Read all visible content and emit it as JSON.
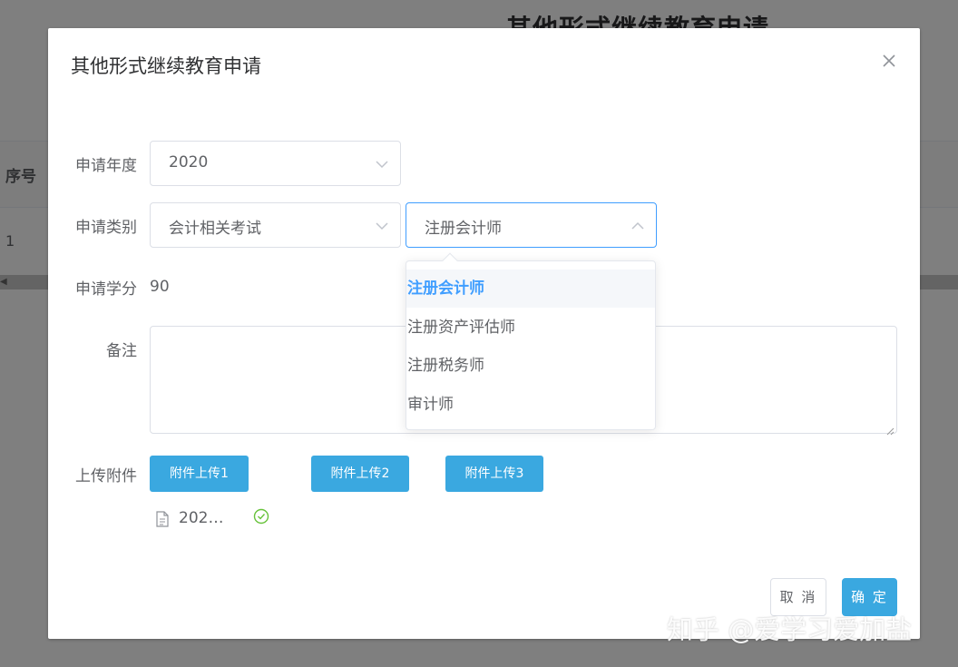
{
  "background": {
    "title": "其他形式继续教育申请",
    "column_header": "序号",
    "row_number": "1"
  },
  "dialog": {
    "title": "其他形式继续教育申请",
    "close_icon": "close-icon"
  },
  "form": {
    "year": {
      "label": "申请年度",
      "value": "2020"
    },
    "category": {
      "label": "申请类别",
      "value": "会计相关考试",
      "sub_value": "注册会计师"
    },
    "credits": {
      "label": "申请学分",
      "value": "90"
    },
    "remark": {
      "label": "备注",
      "value": ""
    },
    "upload": {
      "label": "上传附件",
      "buttons": [
        "附件上传1",
        "附件上传2",
        "附件上传3"
      ],
      "file_name": "202…",
      "file_icon": "document-icon",
      "status_icon": "check-circle-icon"
    }
  },
  "dropdown": {
    "options": [
      "注册会计师",
      "注册资产评估师",
      "注册税务师",
      "审计师"
    ],
    "selected_index": 0
  },
  "footer": {
    "cancel_label": "取 消",
    "confirm_label": "确 定"
  },
  "watermark": "知乎 @爱学习爱加盐",
  "colors": {
    "primary": "#409eff",
    "upload_button": "#3aa8e0",
    "success": "#67c23a",
    "overlay": "rgba(0,0,0,0.5)"
  }
}
